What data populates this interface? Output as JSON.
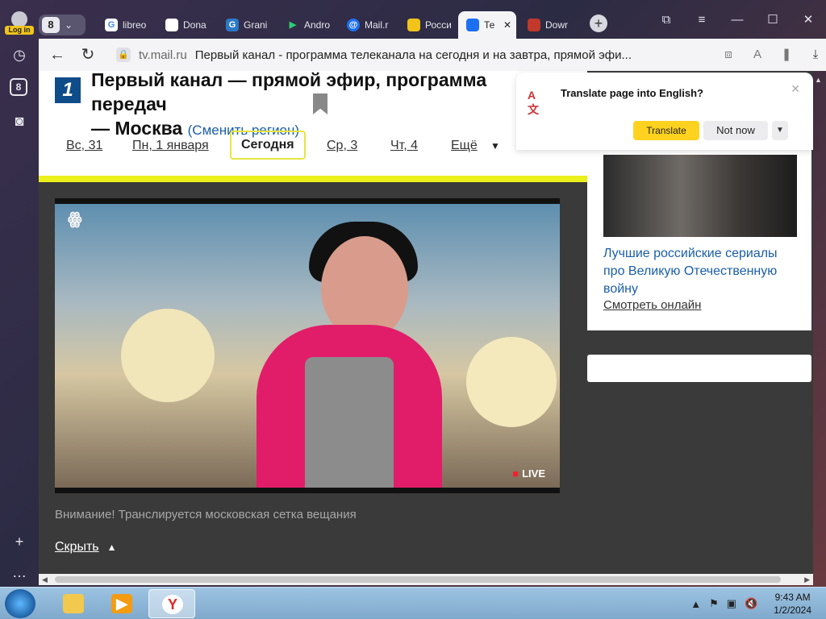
{
  "browser": {
    "login_label": "Log in",
    "tab_count": "8",
    "sidebar_badge": "8",
    "tabs": [
      {
        "label": "libreo",
        "fav_color": "#ffffff",
        "fav_glyph": "G"
      },
      {
        "label": "Dona",
        "fav_color": "#ffffff",
        "fav_glyph": ""
      },
      {
        "label": "Grani",
        "fav_color": "#2a7ac7",
        "fav_glyph": "G"
      },
      {
        "label": "Andro",
        "fav_color": "#2ecc71",
        "fav_glyph": "▶"
      },
      {
        "label": "Mail.r",
        "fav_color": "#1d6ff2",
        "fav_glyph": "@"
      },
      {
        "label": "Росси",
        "fav_color": "#f0c419",
        "fav_glyph": ""
      },
      {
        "label": "Те",
        "fav_color": "#1d6ff2",
        "fav_glyph": ""
      },
      {
        "label": "Dowr",
        "fav_color": "#c0392b",
        "fav_glyph": ""
      }
    ],
    "address_domain": "tv.mail.ru",
    "address_title": "Первый канал - программа телеканала на сегодня и на завтра, прямой эфи..."
  },
  "page": {
    "logo_glyph": "1",
    "heading": "Первый канал — прямой эфир, программа передач",
    "heading_city": "— Москва",
    "change_region": "(Сменить регион)",
    "days": [
      {
        "label": "Вс, 31"
      },
      {
        "label": "Пн, 1 января"
      },
      {
        "label": "Сегодня"
      },
      {
        "label": "Ср, 3"
      },
      {
        "label": "Чт, 4"
      },
      {
        "label": "Ещё"
      }
    ],
    "live_label": "LIVE",
    "notice": "Внимание! Транслируется московская сетка вещания",
    "hide_label": "Скрыть"
  },
  "sidebar_promo": {
    "title": "Лучшие российские сериалы про Великую Отечественную войну",
    "link": "Смотреть онлайн"
  },
  "translate_popup": {
    "question": "Translate page into English?",
    "translate_button": "Translate",
    "not_now_button": "Not now"
  },
  "taskbar": {
    "time": "9:43 AM",
    "date": "1/2/2024"
  }
}
